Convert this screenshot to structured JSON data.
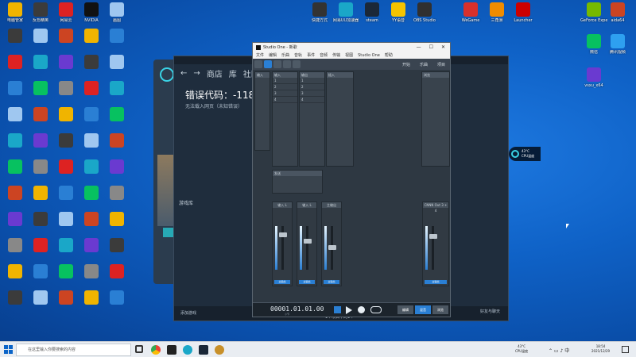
{
  "desktop": {
    "left_icons": [
      {
        "label": "电脑管家",
        "color": "#f0b400"
      },
      {
        "label": "反恐精英",
        "color": "#3b3b3b"
      },
      {
        "label": "网易云",
        "color": "#d22"
      },
      {
        "label": "NVIDIA",
        "color": "#111"
      },
      {
        "label": "画图",
        "color": "#9fc7f0"
      }
    ],
    "top_icons": [
      {
        "label": "快捷方式",
        "color": "#333"
      },
      {
        "label": "网易UU加速器",
        "color": "#1aa7c8"
      },
      {
        "label": "steam",
        "color": "#1b2838"
      },
      {
        "label": "YY语音",
        "color": "#f5c400"
      },
      {
        "label": "OBS Studio",
        "color": "#303030"
      },
      {
        "label": "WeGame",
        "color": "#d8302c"
      },
      {
        "label": "三角洲",
        "color": "#f08c00"
      },
      {
        "label": "Launcher",
        "color": "#c00"
      }
    ],
    "right_icons": [
      {
        "label": "GeForce Experience",
        "color": "#76b900"
      },
      {
        "label": "aida64",
        "color": "#c42"
      },
      {
        "label": "微信",
        "color": "#07c160"
      },
      {
        "label": "腾讯视频",
        "color": "#2ea0f0"
      },
      {
        "label": "vsxu_x64",
        "color": "#6a3ad0"
      }
    ]
  },
  "store": {
    "nav_labels": [
      "商店",
      "库",
      "社区"
    ],
    "error_title": "错误代码：-118",
    "error_message": "无法载入网页（未知错误）",
    "side_labels": [
      "游戏库"
    ],
    "add_game": "添加游戏",
    "download_label": "下载",
    "download_sub": "1个项目中的1个",
    "friends_label": "好友与聊天"
  },
  "studio_one": {
    "title": "Studio One - 新歌",
    "menu": [
      "文件",
      "编辑",
      "乐曲",
      "音轨",
      "事件",
      "音频",
      "传输",
      "视图",
      "Studio One",
      "帮助"
    ],
    "toolbar_buttons": [
      "开始",
      "乐曲",
      "项目"
    ],
    "browser_header": "浏览",
    "inputs_header": "输入",
    "outputs_header": "输出",
    "inserts_header": "插入",
    "sends_header": "发送",
    "strips": [
      {
        "name": "输入 L",
        "bottom": "主输出"
      },
      {
        "name": "输入 L",
        "bottom": "主输出"
      },
      {
        "name": "主输出",
        "bottom": "主输出"
      }
    ],
    "right_strip_name": "CNNN Out 3 + 4",
    "right_strip_bottom": "主输出",
    "time": "00001.01.01.00",
    "time_sub": "小节",
    "tabs": [
      "编辑",
      "混音",
      "浏览"
    ]
  },
  "cpu_widget": {
    "temp": "43°C",
    "label": "CPU温度"
  },
  "taskbar": {
    "search_placeholder": "在这里输入你要搜索的内容",
    "tray_temp": "43°C",
    "tray_temp_label": "CPU温度",
    "time": "18:54",
    "date": "2021/12/29"
  }
}
